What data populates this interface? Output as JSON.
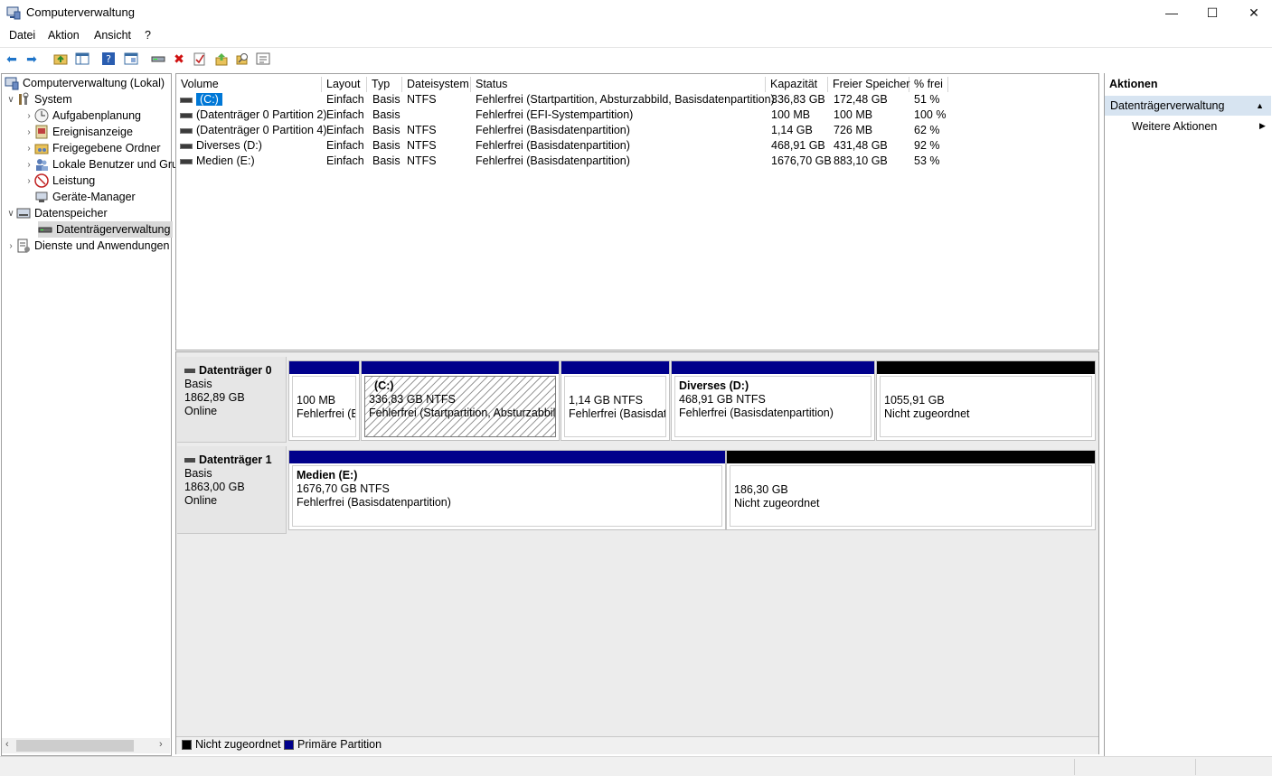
{
  "window": {
    "title": "Computerverwaltung",
    "minimize": "—",
    "maximize": "☐",
    "close": "✕"
  },
  "menu": [
    "Datei",
    "Aktion",
    "Ansicht",
    "?"
  ],
  "toolbar_icons": [
    "back-arrow-icon",
    "forward-arrow-icon",
    "up-folder-icon",
    "show-hide-tree-icon",
    "help-icon",
    "properties-icon",
    "connect-drive-icon",
    "delete-icon",
    "check-icon",
    "export-icon",
    "search-icon",
    "list-icon"
  ],
  "tree": {
    "root": "Computerverwaltung (Lokal)",
    "system": "System",
    "aufgaben": "Aufgabenplanung",
    "ereignis": "Ereignisanzeige",
    "freigegeben": "Freigegebene Ordner",
    "lokale": "Lokale Benutzer und Gru",
    "leistung": "Leistung",
    "geraete": "Geräte-Manager",
    "datenspeicher": "Datenspeicher",
    "datentraeger": "Datenträgerverwaltung",
    "dienste": "Dienste und Anwendungen"
  },
  "columns": {
    "volume": "Volume",
    "layout": "Layout",
    "typ": "Typ",
    "dateisystem": "Dateisystem",
    "status": "Status",
    "kapazitaet": "Kapazität",
    "frei": "Freier Speicher",
    "prozent": "% frei"
  },
  "volumes": [
    {
      "volume": "(C:)",
      "layout": "Einfach",
      "typ": "Basis",
      "fs": "NTFS",
      "status": "Fehlerfrei (Startpartition, Absturzabbild, Basisdatenpartition)",
      "kap": "336,83 GB",
      "frei": "172,48 GB",
      "pct": "51 %"
    },
    {
      "volume": "(Datenträger 0 Partition 2)",
      "layout": "Einfach",
      "typ": "Basis",
      "fs": "",
      "status": "Fehlerfrei (EFI-Systempartition)",
      "kap": "100 MB",
      "frei": "100 MB",
      "pct": "100 %"
    },
    {
      "volume": "(Datenträger 0 Partition 4)",
      "layout": "Einfach",
      "typ": "Basis",
      "fs": "NTFS",
      "status": "Fehlerfrei (Basisdatenpartition)",
      "kap": "1,14 GB",
      "frei": "726 MB",
      "pct": "62 %"
    },
    {
      "volume": "Diverses (D:)",
      "layout": "Einfach",
      "typ": "Basis",
      "fs": "NTFS",
      "status": "Fehlerfrei (Basisdatenpartition)",
      "kap": "468,91 GB",
      "frei": "431,48 GB",
      "pct": "92 %"
    },
    {
      "volume": "Medien (E:)",
      "layout": "Einfach",
      "typ": "Basis",
      "fs": "NTFS",
      "status": "Fehlerfrei (Basisdatenpartition)",
      "kap": "1676,70 GB",
      "frei": "883,10 GB",
      "pct": "53 %"
    }
  ],
  "disk0": {
    "name": "Datenträger 0",
    "type": "Basis",
    "size": "1862,89 GB",
    "state": "Online",
    "p1": {
      "l1": "100 MB",
      "l2": "Fehlerfrei (EI"
    },
    "p2": {
      "name": "(C:)",
      "l1": "336,83 GB NTFS",
      "l2": "Fehlerfrei (Startpartition, Absturzabbild,"
    },
    "p3": {
      "l1": "1,14 GB NTFS",
      "l2": "Fehlerfrei (Basisdate"
    },
    "p4": {
      "name": "Diverses  (D:)",
      "l1": "468,91 GB NTFS",
      "l2": "Fehlerfrei (Basisdatenpartition)"
    },
    "p5": {
      "l1": "1055,91 GB",
      "l2": "Nicht zugeordnet"
    }
  },
  "disk1": {
    "name": "Datenträger 1",
    "type": "Basis",
    "size": "1863,00 GB",
    "state": "Online",
    "p1": {
      "name": "Medien  (E:)",
      "l1": "1676,70 GB NTFS",
      "l2": "Fehlerfrei (Basisdatenpartition)"
    },
    "p2": {
      "l1": "186,30 GB",
      "l2": "Nicht zugeordnet"
    }
  },
  "legend": {
    "unallocated": "Nicht zugeordnet",
    "primary": "Primäre Partition"
  },
  "actions": {
    "title": "Aktionen",
    "section": "Datenträgerverwaltung",
    "more": "Weitere Aktionen"
  },
  "colors": {
    "primary_partition": "#00008b",
    "unallocated": "#000000",
    "selection": "#0078d7",
    "actions_section": "#d7e4f1"
  }
}
